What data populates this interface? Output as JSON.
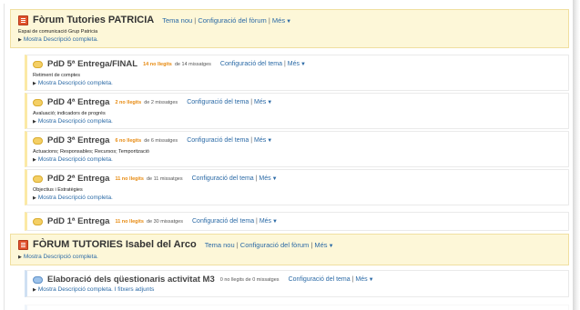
{
  "forums": [
    {
      "title": "Fòrum Tutories PATRICIA",
      "links": [
        "Tema nou",
        "Configuració del fòrum",
        "Més"
      ],
      "description": "Espai de comunicació Grup Patricia",
      "more": "Mostra Descripció completa."
    },
    {
      "title": "FÒRUM TUTORIES Isabel del Arco",
      "links": [
        "Tema nou",
        "Configuració del fòrum",
        "Més"
      ],
      "description": "",
      "more": "Mostra Descripció completa."
    }
  ],
  "topics": [
    {
      "title": "PdD 5ª Entrega/FINAL",
      "unread": "14 no llegits",
      "messages": "de 14 missatges",
      "links": [
        "Configuració del tema",
        "Més"
      ],
      "description": "Retiment de comptes",
      "more": "Mostra Descripció completa."
    },
    {
      "title": "PdD 4ª Entrega",
      "unread": "2 no llegits",
      "messages": "de 2 missatges",
      "links": [
        "Configuració del tema",
        "Més"
      ],
      "description": "Avaluació; indicadors de progrés",
      "more": "Mostra Descripció completa."
    },
    {
      "title": "PdD 3ª Entrega",
      "unread": "6 no llegits",
      "messages": "de 6 missatges",
      "links": [
        "Configuració del tema",
        "Més"
      ],
      "description": "Actuacions; Responsables; Recursos; Temporització",
      "more": "Mostra Descripció completa."
    },
    {
      "title": "PdD 2ª Entrega",
      "unread": "11 no llegits",
      "messages": "de 11 missatges",
      "links": [
        "Configuració del tema",
        "Més"
      ],
      "description": "Objectius i Estratègies",
      "more": "Mostra Descripció completa."
    },
    {
      "title": "PdD 1ª Entrega",
      "unread": "11 no llegits",
      "messages": "de 30 missatges",
      "links": [
        "Configuració del tema",
        "Més"
      ],
      "description": "",
      "more": ""
    },
    {
      "title": "Elaboració dels qüestionaris activitat M3",
      "unread": "",
      "messages": "0 no llegits de 0 missatges",
      "links": [
        "Configuració del tema",
        "Més"
      ],
      "description": "",
      "more": "Mostra Descripció completa. I fitxers adjunts"
    }
  ]
}
